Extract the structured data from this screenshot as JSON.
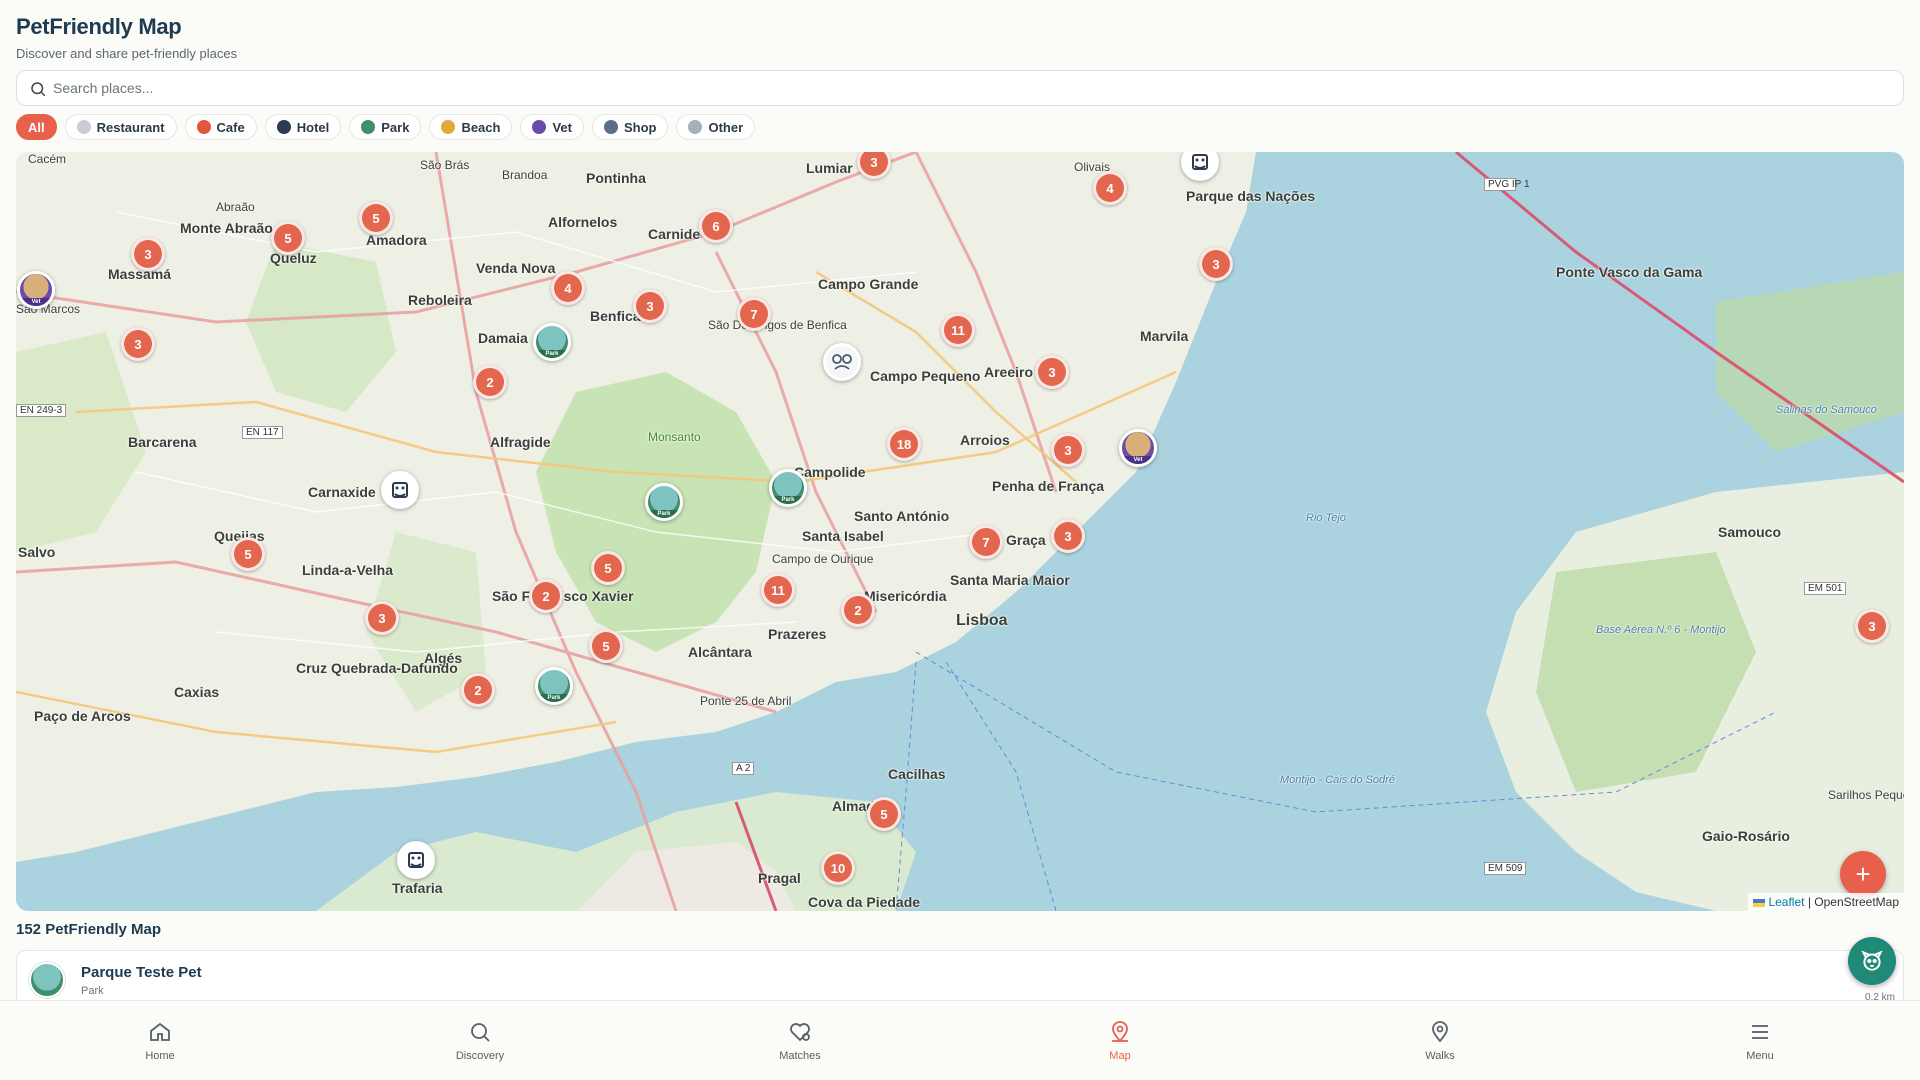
{
  "app": {
    "title": "PetFriendly Map",
    "subtitle": "Discover and share pet-friendly places"
  },
  "search": {
    "placeholder": "Search places..."
  },
  "filters": [
    {
      "label": "All",
      "active": true
    },
    {
      "label": "Restaurant",
      "icon": "restaurant-icon"
    },
    {
      "label": "Cafe",
      "icon": "cafe-icon"
    },
    {
      "label": "Hotel",
      "icon": "hotel-icon"
    },
    {
      "label": "Park",
      "icon": "park-icon"
    },
    {
      "label": "Beach",
      "icon": "beach-icon"
    },
    {
      "label": "Vet",
      "icon": "vet-icon"
    },
    {
      "label": "Shop",
      "icon": "shop-icon"
    },
    {
      "label": "Other",
      "icon": "other-icon"
    }
  ],
  "map": {
    "clusters": [
      "3",
      "4",
      "5",
      "3",
      "3",
      "5",
      "5",
      "4",
      "3",
      "6",
      "7",
      "11",
      "3",
      "3",
      "2",
      "18",
      "3",
      "7",
      "3",
      "2",
      "11",
      "2",
      "5",
      "3",
      "5",
      "2",
      "5",
      "10",
      "3",
      "3"
    ],
    "pin_tags": {
      "park": "Park",
      "vet": "Vet"
    },
    "labels": {
      "cacem": "Cacém",
      "sao_bras": "São Brás",
      "brandoa": "Brandoa",
      "pontinha": "Pontinha",
      "lumiar": "Lumiar",
      "olivais": "Olivais",
      "parque_nacoes": "Parque das Nações",
      "abraao": "Abraão",
      "monte_abraao": "Monte Abraão",
      "queluz": "Queluz",
      "amadora": "Amadora",
      "alfornelos": "Alfornelos",
      "carnide": "Carnide",
      "massama": "Massamá",
      "venda_nova": "Venda Nova",
      "reboleira": "Reboleira",
      "campo_grande": "Campo Grande",
      "benfica": "Benfica",
      "sao_marcos": "São Marcos",
      "damaia": "Damaia",
      "sao_domingos": "São Domingos de Benfica",
      "marvila": "Marvila",
      "campo_pequeno": "Campo Pequeno",
      "areeiro": "Areeiro",
      "barcarena": "Barcarena",
      "alfragide": "Alfragide",
      "monsanto": "Monsanto",
      "arroios": "Arroios",
      "carnaxide": "Carnaxide",
      "campolide": "Campolide",
      "penha_franca": "Penha de França",
      "santo_antonio": "Santo António",
      "santa_isabel": "Santa Isabel",
      "graca": "Graça",
      "queijas": "Queijas",
      "salvo": "Salvo",
      "linda_velha": "Linda-a-Velha",
      "campo_ourique": "Campo de Ourique",
      "santa_maria_maior": "Santa Maria Maior",
      "misericordia": "Misericórdia",
      "sao_francisco_xavier": "São Francisco Xavier",
      "lisboa": "Lisboa",
      "prazeres": "Prazeres",
      "alcantara": "Alcântara",
      "alges": "Algés",
      "cruz_quebrada": "Cruz Quebrada-Dafundo",
      "caxias": "Caxias",
      "paco_arcos": "Paço de Arcos",
      "ponte_25": "Ponte 25 de Abril",
      "cacilhas": "Cacilhas",
      "almada": "Almada",
      "pragal": "Pragal",
      "cova_piedade": "Cova da Piedade",
      "trafaria": "Trafaria",
      "ponte_vasco": "Ponte Vasco da Gama",
      "samouco": "Samouco",
      "salinas": "Salinas do Samouco",
      "base_aerea": "Base Aérea N.º 6 - Montijo",
      "gaio_rosario": "Gaio-Rosário",
      "sarilhos": "Sarilhos Pequenos",
      "montijo_sodre": "Montijo - Cais do Sodré",
      "rio_tejo": "Rio Tejo"
    },
    "shields": {
      "en_249_3": "EN 249-3",
      "en_117": "EN 117",
      "a2": "A 2",
      "em_501": "EM 501",
      "em_509": "EM 509",
      "pvg": "PVG IP 1"
    },
    "attribution": {
      "leaflet": "Leaflet",
      "osm": "| OpenStreetMap"
    },
    "add_button": "+"
  },
  "results": {
    "count_label": "152 PetFriendly Map",
    "items": [
      {
        "name": "Parque Teste Pet",
        "type": "Park",
        "distance": "0.2 km"
      }
    ]
  },
  "nav": [
    {
      "label": "Home",
      "icon": "home-icon"
    },
    {
      "label": "Discovery",
      "icon": "search-icon"
    },
    {
      "label": "Matches",
      "icon": "heart-icon"
    },
    {
      "label": "Map",
      "icon": "map-pin-icon",
      "active": true
    },
    {
      "label": "Walks",
      "icon": "location-icon"
    },
    {
      "label": "Menu",
      "icon": "menu-icon"
    }
  ],
  "colors": {
    "accent": "#e8604c",
    "water": "#aad3df",
    "teal": "#1f8a77",
    "title": "#1e3a52"
  }
}
